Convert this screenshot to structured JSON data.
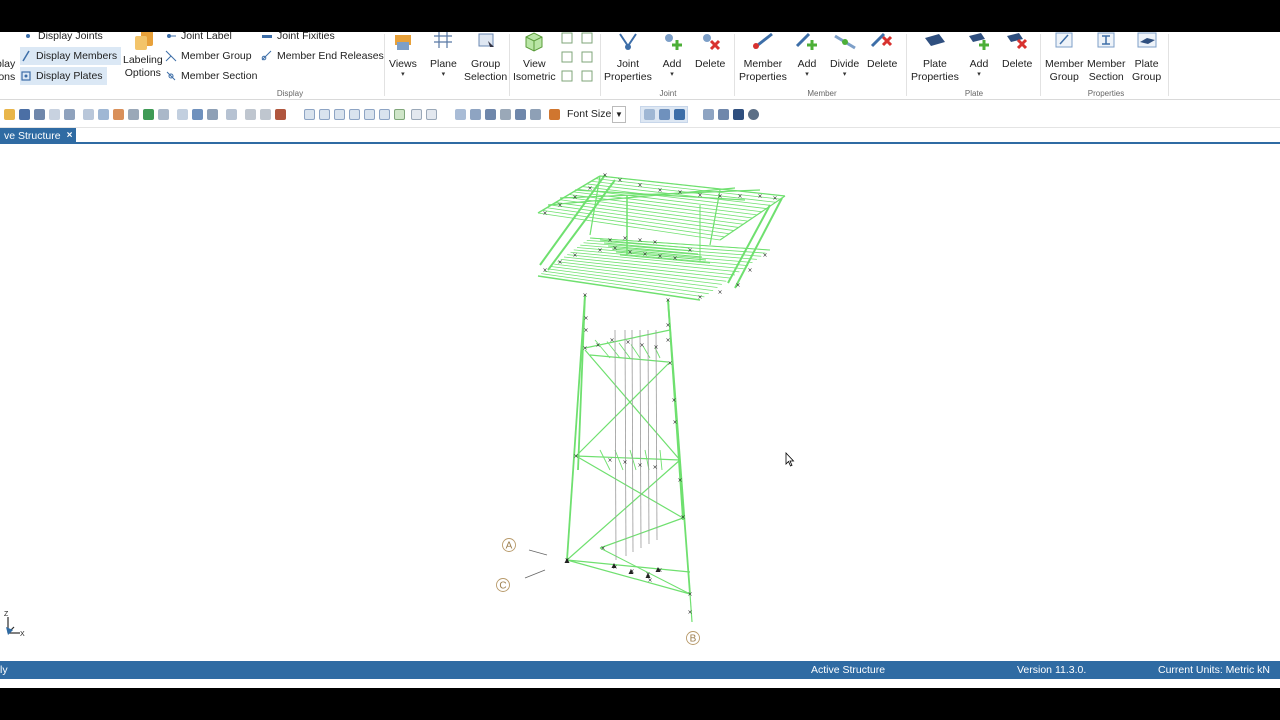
{
  "ribbon": {
    "display_items": {
      "joints": "Display Joints",
      "members": "Display Members",
      "plates": "Display Plates"
    },
    "display_left_cut": [
      "play",
      "ions"
    ],
    "labeling_options": "Labeling\nOptions",
    "label_items": {
      "joint_label": "Joint Label",
      "member_group": "Member Group",
      "member_section": "Member Section",
      "joint_fixities": "Joint Fixities",
      "member_end_releases": "Member End Releases"
    },
    "buttons": {
      "views": "Views",
      "plane": "Plane",
      "group_selection_1": "Group",
      "group_selection_2": "Selection",
      "view_isometric_1": "View",
      "view_isometric_2": "Isometric",
      "joint_properties_1": "Joint",
      "joint_properties_2": "Properties",
      "joint_add": "Add",
      "joint_delete": "Delete",
      "member_properties_1": "Member",
      "member_properties_2": "Properties",
      "member_add": "Add",
      "member_divide": "Divide",
      "member_delete": "Delete",
      "plate_properties_1": "Plate",
      "plate_properties_2": "Properties",
      "plate_add": "Add",
      "plate_delete": "Delete",
      "member_group_1": "Member",
      "member_group_2": "Group",
      "member_section_1": "Member",
      "member_section_2": "Section",
      "plate_group_1": "Plate",
      "plate_group_2": "Group"
    },
    "groups": {
      "display": "Display",
      "joint": "Joint",
      "member": "Member",
      "plate": "Plate",
      "properties": "Properties"
    }
  },
  "toolbar": {
    "font_size_label": "Font Size"
  },
  "tab": {
    "label": "ve Structure",
    "close": "×"
  },
  "viewport": {
    "grid_labels": {
      "a": "A",
      "c": "C",
      "b": "B"
    },
    "axes": {
      "z": "Z",
      "x": "X"
    },
    "member_color": "#6fe06f",
    "joint_color": "#222222"
  },
  "status": {
    "left": "ly",
    "center": "Active Structure",
    "version": "Version 11.3.0.",
    "units": "Current Units: Metric kN"
  },
  "colors": {
    "status_bar": "#2f6ba3",
    "selected_bg": "#dbe8f5"
  }
}
